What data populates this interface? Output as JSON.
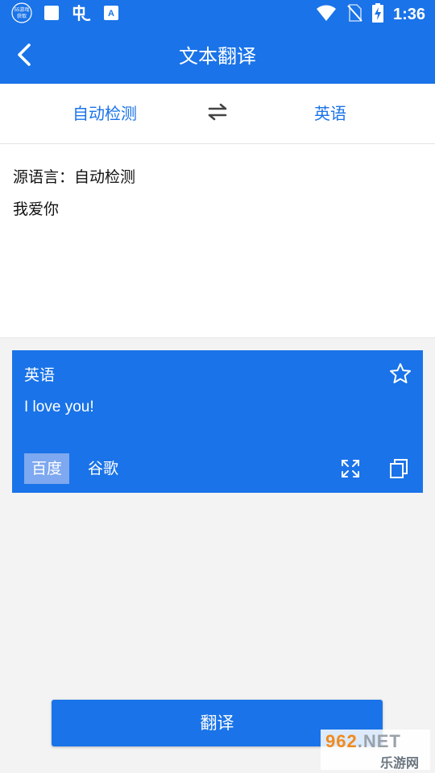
{
  "statusbar": {
    "time": "1:36",
    "badge_line1": "55游戏",
    "badge_line2": "获取",
    "keyboard_glyph": "A",
    "icons": [
      "app-badge-icon",
      "square-icon",
      "chinese-char-icon",
      "keyboard-icon",
      "wifi-icon",
      "no-sim-icon",
      "battery-charging-icon"
    ]
  },
  "appbar": {
    "title": "文本翻译",
    "back_icon": "chevron-left-icon"
  },
  "language_bar": {
    "source": "自动检测",
    "target": "英语",
    "swap_icon": "swap-arrows-icon"
  },
  "input": {
    "source_label": "源语言：自动检测",
    "text": "我爱你"
  },
  "result": {
    "language": "英语",
    "text": "I love you!",
    "engines": [
      "百度",
      "谷歌"
    ],
    "selected_engine": "百度",
    "actions": [
      "star-icon",
      "expand-icon",
      "copy-icon"
    ]
  },
  "translate_button": {
    "label": "翻译"
  },
  "watermark": {
    "number": "962",
    "suffix": ".NET",
    "text": "乐游网"
  },
  "colors": {
    "primary": "#1a73e8",
    "background": "#f3f3f3",
    "selected_engine_bg": "#7ea8ef"
  }
}
